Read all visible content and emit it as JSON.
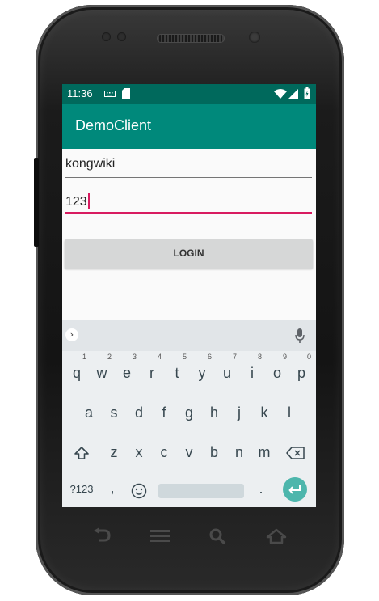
{
  "status_bar": {
    "time": "11:36"
  },
  "app_bar": {
    "title": "DemoClient"
  },
  "form": {
    "username_value": "kongwiki",
    "password_value": "123",
    "login_label": "LOGIN"
  },
  "keyboard": {
    "row1": [
      {
        "key": "q",
        "hint": "1"
      },
      {
        "key": "w",
        "hint": "2"
      },
      {
        "key": "e",
        "hint": "3"
      },
      {
        "key": "r",
        "hint": "4"
      },
      {
        "key": "t",
        "hint": "5"
      },
      {
        "key": "y",
        "hint": "6"
      },
      {
        "key": "u",
        "hint": "7"
      },
      {
        "key": "i",
        "hint": "8"
      },
      {
        "key": "o",
        "hint": "9"
      },
      {
        "key": "p",
        "hint": "0"
      }
    ],
    "row2": [
      "a",
      "s",
      "d",
      "f",
      "g",
      "h",
      "j",
      "k",
      "l"
    ],
    "row3": [
      "z",
      "x",
      "c",
      "v",
      "b",
      "n",
      "m"
    ],
    "symbols_label": "?123",
    "comma": ",",
    "period": "."
  },
  "icons": {
    "status": [
      "keyboard-icon",
      "sd-card-icon",
      "wifi-icon",
      "signal-icon",
      "battery-icon"
    ],
    "keyboard": [
      "chevron-right-icon",
      "microphone-icon",
      "shift-icon",
      "backspace-icon",
      "emoji-icon",
      "enter-icon"
    ],
    "nav": [
      "back-icon",
      "menu-icon",
      "search-icon",
      "home-icon"
    ]
  },
  "colors": {
    "status_bar": "#00695c",
    "app_bar": "#00897b",
    "accent": "#d81b60",
    "enter_key": "#4db6ac"
  }
}
